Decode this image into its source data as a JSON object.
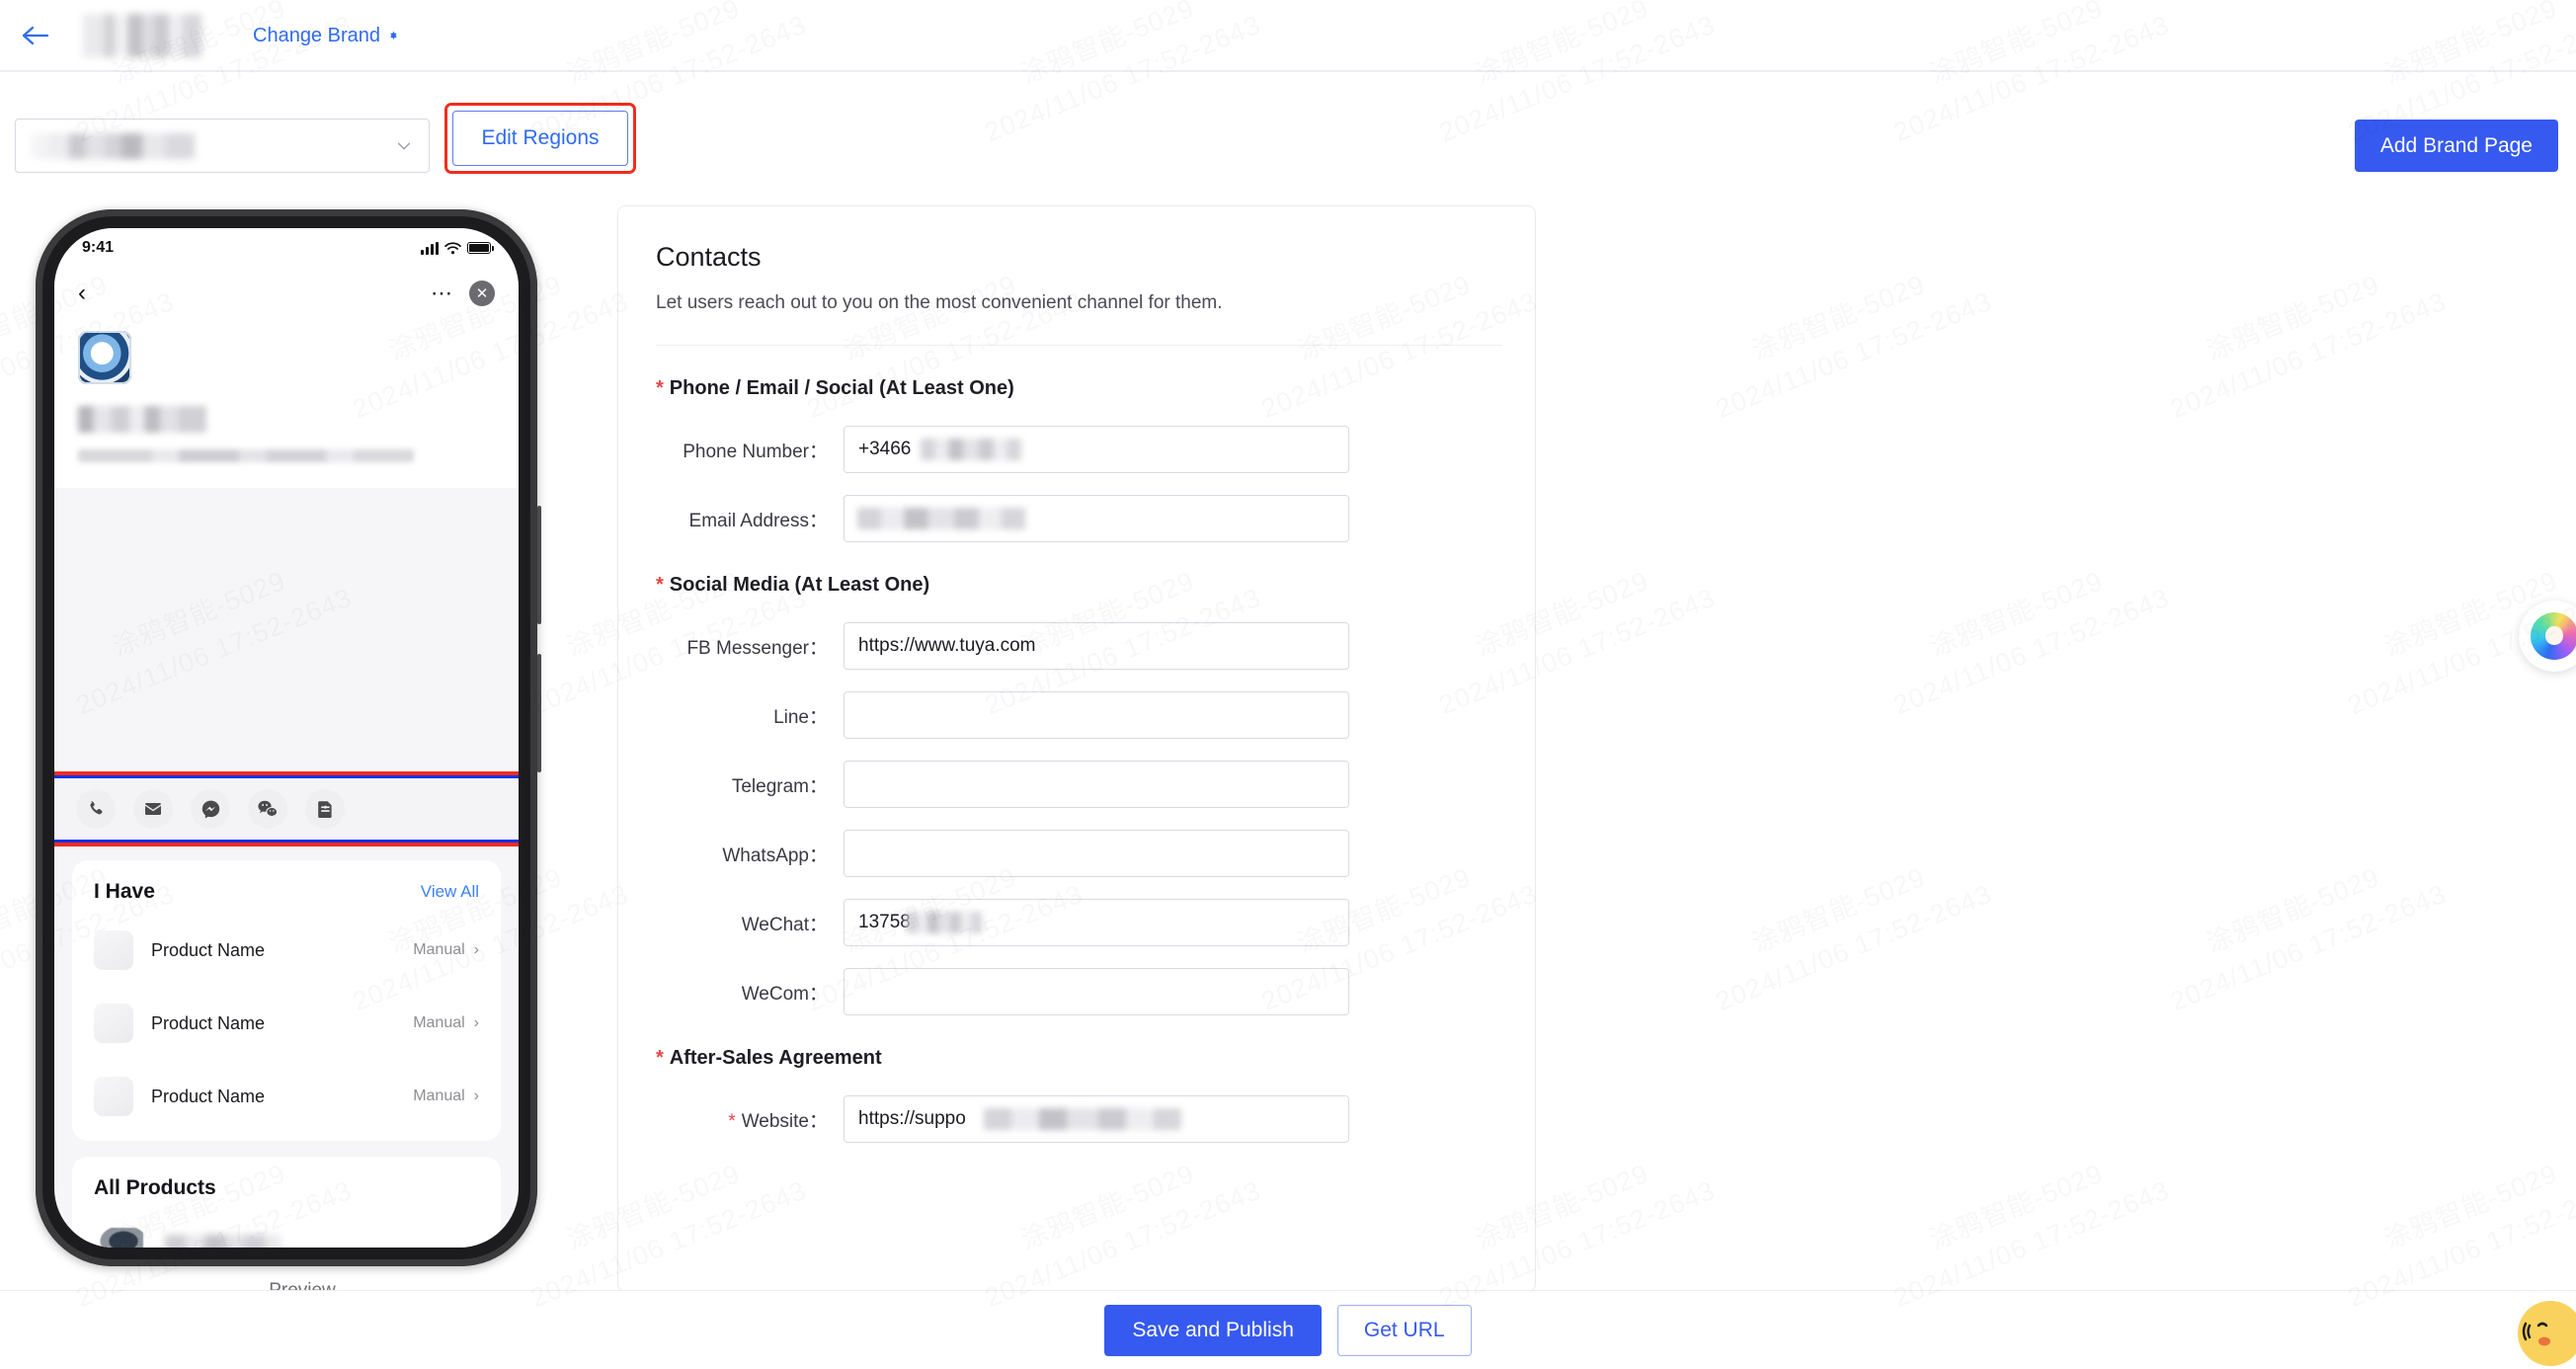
{
  "topbar": {
    "back_icon": "arrow-left-icon",
    "brand_logo_alt": "brand-logo-blurred",
    "change_brand_label": "Change Brand"
  },
  "actionbar": {
    "brand_select_value": "",
    "brand_select_icon": "chevron-down-icon",
    "edit_regions_label": "Edit Regions",
    "add_brand_page_label": "Add Brand Page"
  },
  "preview": {
    "label": "Preview",
    "status_bar": {
      "time": "9:41",
      "signal_icon": "signal-bars-icon",
      "wifi_icon": "wifi-icon",
      "battery_icon": "battery-icon"
    },
    "nav": {
      "back_icon": "chevron-left-icon",
      "more_icon": "more-dots-icon",
      "close_icon": "close-circle-icon"
    },
    "contact_icons": [
      {
        "name": "phone-icon"
      },
      {
        "name": "mail-icon"
      },
      {
        "name": "messenger-icon"
      },
      {
        "name": "wechat-icon"
      },
      {
        "name": "document-icon"
      }
    ],
    "i_have": {
      "title": "I Have",
      "view_all": "View All",
      "rows": [
        {
          "name": "Product Name",
          "action": "Manual"
        },
        {
          "name": "Product Name",
          "action": "Manual"
        },
        {
          "name": "Product Name",
          "action": "Manual"
        }
      ]
    },
    "all_products": {
      "title": "All Products"
    }
  },
  "form": {
    "title": "Contacts",
    "subtitle": "Let users reach out to you on the most convenient channel for them.",
    "section_contact": "Phone / Email / Social (At Least One)",
    "section_social": "Social Media (At Least One)",
    "section_aftersales": "After-Sales Agreement",
    "fields": {
      "phone_label": "Phone Number：",
      "phone_value": "+3466",
      "email_label": "Email Address：",
      "email_value": "",
      "fb_label": "FB Messenger：",
      "fb_value": "https://www.tuya.com",
      "line_label": "Line：",
      "line_value": "",
      "telegram_label": "Telegram：",
      "telegram_value": "",
      "whatsapp_label": "WhatsApp：",
      "whatsapp_value": "",
      "wechat_label": "WeChat：",
      "wechat_value": "13758",
      "wecom_label": "WeCom：",
      "wecom_value": "",
      "website_label": "Website：",
      "website_value": "https://suppo"
    }
  },
  "footer": {
    "save_label": "Save and Publish",
    "get_url_label": "Get URL"
  },
  "watermark": {
    "line1": "涂鸦智能-5029",
    "line2": "2024/11/06 17:52-2643"
  },
  "colors": {
    "accent_blue": "#3659f0",
    "link_blue": "#2f6bf3",
    "highlight_red": "#ef2d20",
    "highlight_blue": "#1331e8",
    "required_red": "#e64545"
  }
}
